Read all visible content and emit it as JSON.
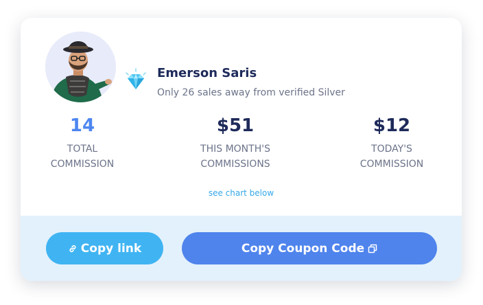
{
  "profile": {
    "name": "Emerson Saris",
    "status_text": "Only 26 sales away from verified Silver",
    "avatar_icon": "person-avatar",
    "badge_icon": "diamond-icon"
  },
  "stats": [
    {
      "value": "14",
      "label_line1": "TOTAL",
      "label_line2": "COMMISSION"
    },
    {
      "value": "$51",
      "label_line1": "THIS MONTH'S",
      "label_line2": "COMMISSIONS"
    },
    {
      "value": "$12",
      "label_line1": "TODAY'S",
      "label_line2": "COMMISSION"
    }
  ],
  "see_chart_link": "see chart below",
  "actions": {
    "copy_link_label": "Copy link",
    "copy_link_icon": "link-icon",
    "copy_coupon_label": "Copy Coupon Code",
    "copy_coupon_icon": "copy-icon"
  },
  "colors": {
    "accent_blue": "#4f84ec",
    "light_blue": "#40b4f2",
    "footer_bg": "#e3f1fc",
    "heading": "#1e2a5a",
    "stat_highlight": "#4d86f0"
  }
}
